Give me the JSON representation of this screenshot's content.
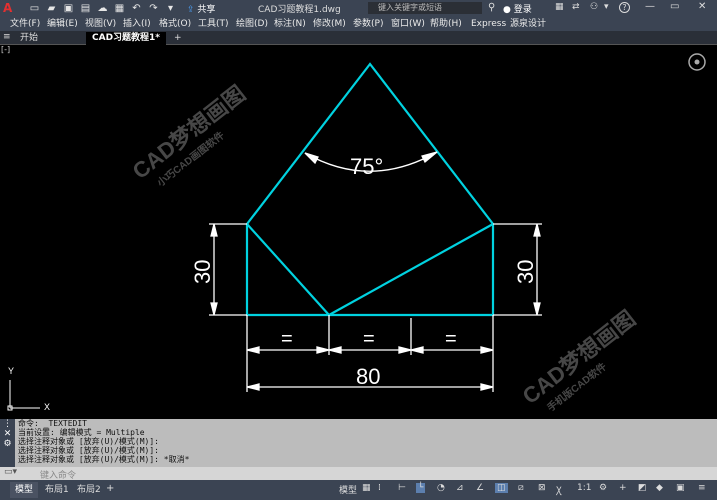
{
  "title_bar": {
    "title": "CAD习题教程1.dwg",
    "share_label": "共享",
    "search_placeholder": "键入关键字或短语",
    "login_label": "登录"
  },
  "menu": {
    "items": [
      "文件(F)",
      "编辑(E)",
      "视图(V)",
      "插入(I)",
      "格式(O)",
      "工具(T)",
      "绘图(D)",
      "标注(N)",
      "修改(M)",
      "参数(P)",
      "窗口(W)",
      "帮助(H)",
      "Express",
      "源泉设计"
    ]
  },
  "tabs": {
    "items": [
      "开始",
      "CAD习题教程1*"
    ],
    "active_index": 1,
    "add_label": "+"
  },
  "drawing": {
    "angle_label": "75°",
    "left_height": "30",
    "right_height": "30",
    "equal_1": "=",
    "equal_2": "=",
    "equal_3": "=",
    "total_width": "80",
    "ucs_x": "X",
    "ucs_y": "Y",
    "watermark_main": "CAD梦想画图",
    "watermark_sub_top": "小巧CAD画图软件",
    "watermark_sub_bottom": "手机版CAD软件",
    "colors": {
      "geometry": "#00d2e0",
      "dimension": "#ffffff"
    }
  },
  "command": {
    "lines": [
      "命令: _TEXTEDIT",
      "当前设置: 编辑模式 = Multiple",
      "选择注释对象或 [放弃(U)/模式(M)]:",
      "选择注释对象或 [放弃(U)/模式(M)]:",
      "选择注释对象或 [放弃(U)/模式(M)]: *取消*"
    ],
    "input_placeholder": "键入命令"
  },
  "status": {
    "layout_tabs": [
      "模型",
      "布局1",
      "布局2"
    ],
    "active_tab": 0,
    "model_label": "模型",
    "scale_label": "1:1"
  }
}
